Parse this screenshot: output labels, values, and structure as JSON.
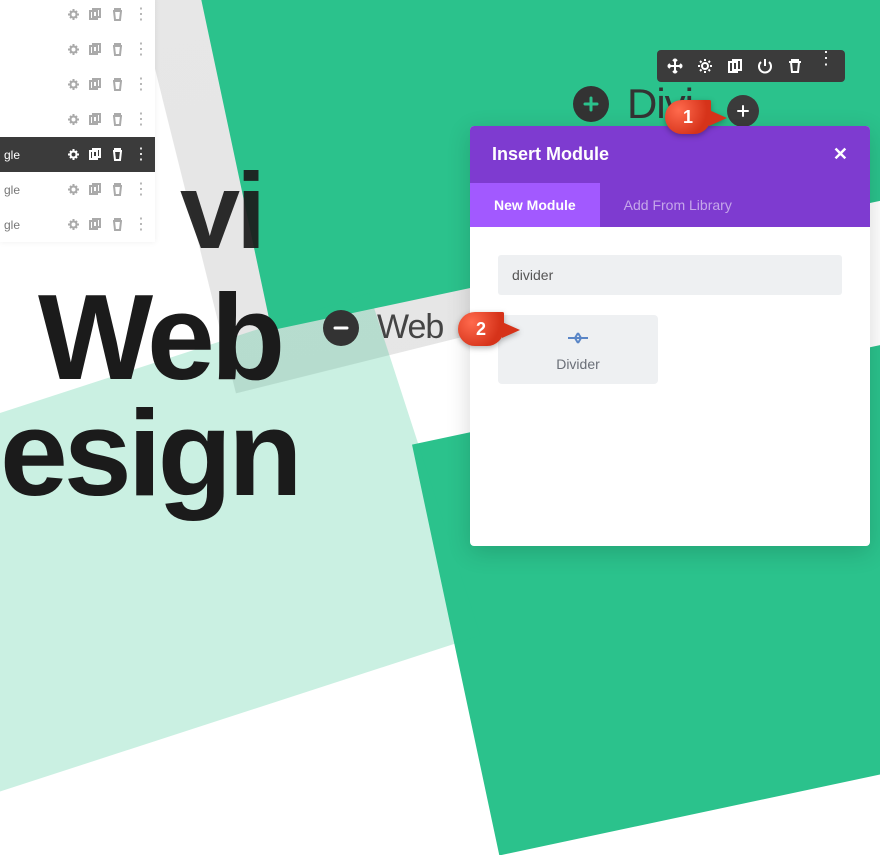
{
  "layer_panel": {
    "rows": [
      {
        "label": ""
      },
      {
        "label": ""
      },
      {
        "label": ""
      },
      {
        "label": ""
      },
      {
        "label": "gle",
        "active": true
      },
      {
        "label": "gle"
      },
      {
        "label": "gle"
      }
    ]
  },
  "bg_words": {
    "vi": "vi",
    "web": "Web",
    "design": "esign"
  },
  "inline_rows": {
    "top_word": "Divi",
    "mid_word": "Web"
  },
  "modal": {
    "title": "Insert Module",
    "tabs": {
      "new": "New Module",
      "library": "Add From Library"
    },
    "search_value": "divider",
    "result": {
      "label": "Divider"
    }
  },
  "markers": {
    "one": "1",
    "two": "2"
  },
  "icons": {
    "gear": "gear-icon",
    "dup": "duplicate-icon",
    "trash": "trash-icon",
    "more": "more-icon",
    "move": "move-icon",
    "power": "power-icon",
    "plus": "plus-icon",
    "minus": "minus-icon",
    "close": "close-icon",
    "divider": "divider-icon"
  }
}
